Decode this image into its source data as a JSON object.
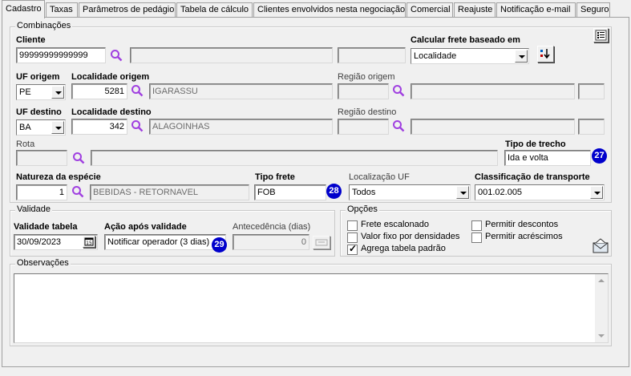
{
  "tabs": [
    "Cadastro",
    "Taxas",
    "Parâmetros de pedágio",
    "Tabela de cálculo",
    "Clientes envolvidos nesta negociação",
    "Comercial",
    "Reajuste",
    "Notificação e-mail",
    "Seguro"
  ],
  "combinacoes": {
    "title": "Combinações",
    "cliente_label": "Cliente",
    "cliente_value": "99999999999999",
    "cliente_nome": "",
    "calcular_label": "Calcular frete baseado em",
    "calcular_value": "Localidade",
    "uf_origem_label": "UF origem",
    "uf_origem_value": "PE",
    "localidade_origem_label": "Localidade origem",
    "localidade_origem_code": "5281",
    "localidade_origem_nome": "IGARASSU",
    "regiao_origem_label": "Região origem",
    "uf_destino_label": "UF destino",
    "uf_destino_value": "BA",
    "localidade_destino_label": "Localidade destino",
    "localidade_destino_code": "342",
    "localidade_destino_nome": "ALAGOINHAS",
    "regiao_destino_label": "Região destino",
    "rota_label": "Rota",
    "tipo_trecho_label": "Tipo de trecho",
    "tipo_trecho_value": "Ida e volta",
    "tipo_trecho_badge": "27",
    "natureza_label": "Natureza da espécie",
    "natureza_code": "1",
    "natureza_nome": "BEBIDAS - RETORNAVEL",
    "tipo_frete_label": "Tipo frete",
    "tipo_frete_value": "FOB",
    "tipo_frete_badge": "28",
    "localizacao_uf_label": "Localização UF",
    "localizacao_uf_value": "Todos",
    "classificacao_label": "Classificação de transporte",
    "classificacao_value": "001.02.005"
  },
  "validade": {
    "title": "Validade",
    "validade_tabela_label": "Validade tabela",
    "validade_tabela_value": "30/09/2023",
    "acao_label": "Ação após validade",
    "acao_value": "Notificar operador (3 dias)",
    "acao_badge": "29",
    "antecedencia_label": "Antecedência (dias)",
    "antecedencia_value": "0"
  },
  "opcoes": {
    "title": "Opções",
    "items": [
      {
        "label": "Frete escalonado",
        "checked": false
      },
      {
        "label": "Valor fixo por densidades",
        "checked": false
      },
      {
        "label": "Agrega tabela padrão",
        "checked": true
      },
      {
        "label": "Permitir descontos",
        "checked": false
      },
      {
        "label": "Permitir acréscimos",
        "checked": false
      }
    ]
  },
  "observacoes": {
    "title": "Observações",
    "text": ""
  },
  "colors": {
    "badge": "#0000cc",
    "lens": "#a040e0",
    "background": "#f0f0f0"
  }
}
